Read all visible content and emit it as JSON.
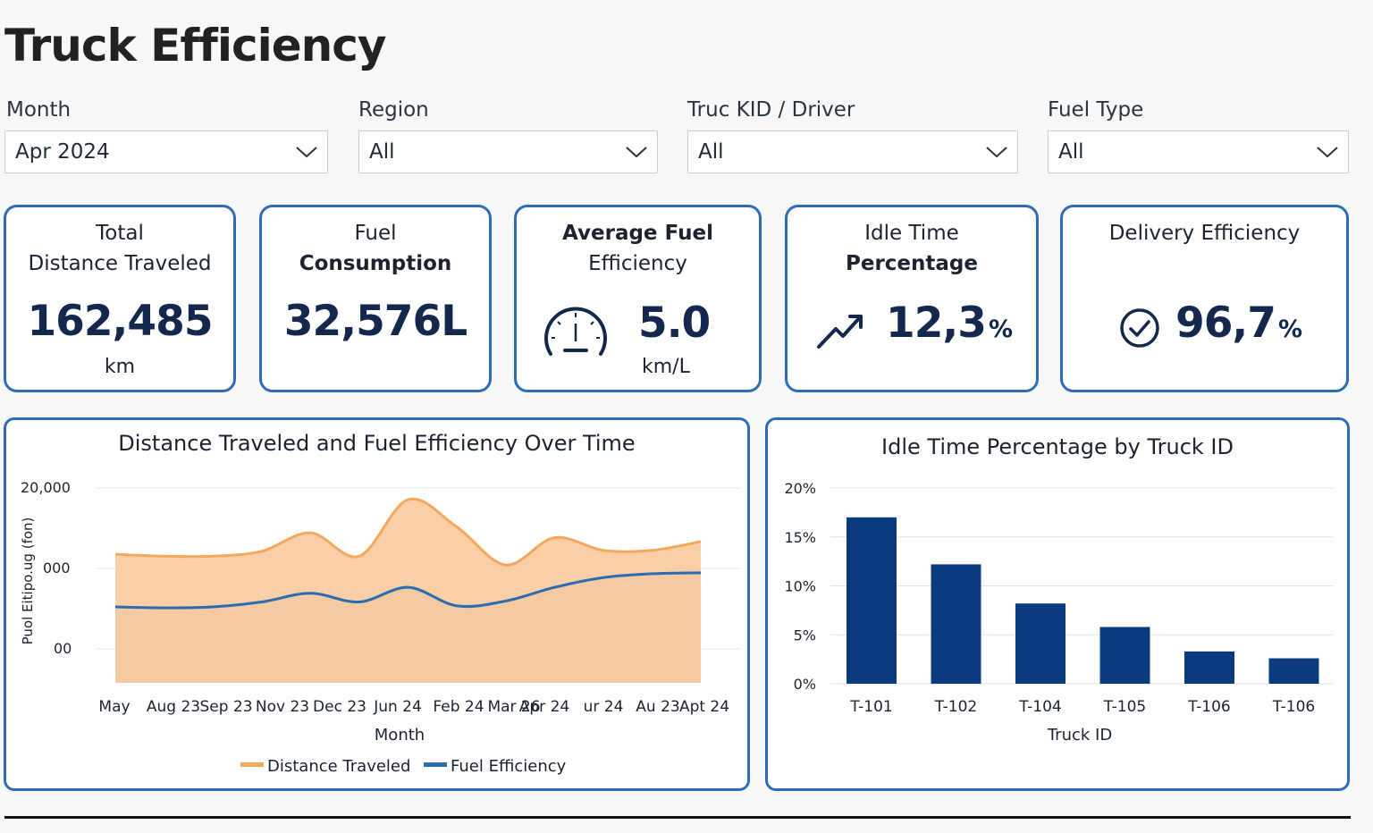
{
  "header": {
    "title": "Truck Efficiency"
  },
  "filters": {
    "month": {
      "label": "Month",
      "value": "Apr 2024"
    },
    "region": {
      "label": "Region",
      "value": "All"
    },
    "truck": {
      "label": "Truc KID / Driver",
      "value": "All"
    },
    "fuel": {
      "label": "Fuel Type",
      "value": "All"
    }
  },
  "kpis": {
    "distance": {
      "title_line1": "Total",
      "title_line2": "Distance Traveled",
      "value": "162,485",
      "unit": "km"
    },
    "fuel": {
      "title_line1": "Fuel",
      "title_line2": "Consumption",
      "value": "32,576L"
    },
    "avg": {
      "title_line1": "Average Fuel",
      "title_line2": "Efficiency",
      "value": "5.0",
      "unit": "km/L",
      "icon": "speedometer-icon"
    },
    "idle": {
      "title_line1": "Idle Time",
      "title_line2": "Percentage",
      "value": "12,3",
      "suffix": "%",
      "icon": "trend-up-icon"
    },
    "delivery": {
      "title": "Delivery Efficiency",
      "value": "96,7",
      "suffix": "%",
      "icon": "check-circle-icon"
    }
  },
  "colors": {
    "accent": "#2f6cb8",
    "navy": "#0b3b7f",
    "orange_fill": "#f7cba0",
    "orange_line": "#f4a85b",
    "gray_fill": "#bfbdb7",
    "blue_line": "#2b6cb0"
  },
  "chart_data": [
    {
      "type": "area",
      "title": "Distance Traveled and Fuel Efficiency Over Time",
      "xlabel": "Month",
      "ylabel": "Puol Eitipo.ug (fon)",
      "categories": [
        "May",
        "Aug 23",
        "Sep 23",
        "Nov 23",
        "Dec 23",
        "Jun 24",
        "Feb 24",
        "Mar 26",
        "Apr 24",
        "ur 24",
        "Au 23",
        "Apt 24"
      ],
      "yticks": [
        "20,000",
        "000",
        "00"
      ],
      "ylim": [
        0,
        20000
      ],
      "series": [
        {
          "name": "Distance Traveled",
          "values": [
            13200,
            13000,
            13000,
            13500,
            15400,
            13000,
            18800,
            16000,
            12100,
            14900,
            13600,
            13600,
            14500
          ]
        },
        {
          "name": "Fuel Efficiency",
          "values": [
            7800,
            7700,
            7800,
            8300,
            9200,
            8300,
            9800,
            7900,
            8400,
            9800,
            10800,
            11200,
            11300
          ]
        }
      ],
      "grid": true,
      "legend": "bottom"
    },
    {
      "type": "bar",
      "title": "Idle Time Percentage by Truck ID",
      "xlabel": "Truck ID",
      "ylabel": "",
      "categories": [
        "T-101",
        "T-102",
        "T-104",
        "T-105",
        "T-106",
        "T-106"
      ],
      "values": [
        17,
        12.2,
        8.2,
        5.8,
        3.3,
        2.6
      ],
      "yticks": [
        "20%",
        "15%",
        "10%",
        "5%",
        "0%"
      ],
      "ylim": [
        0,
        20
      ],
      "grid": true,
      "legend": "none"
    }
  ]
}
